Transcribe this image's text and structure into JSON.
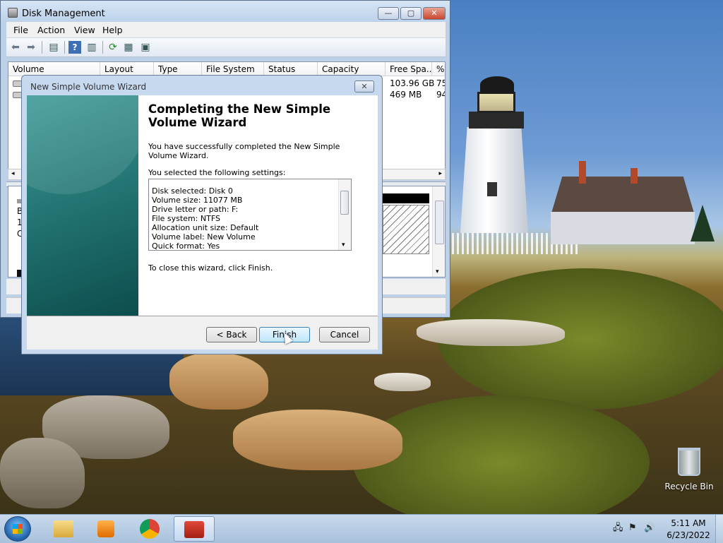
{
  "disk_management": {
    "title": "Disk Management",
    "caption_buttons": {
      "minimize": "—",
      "maximize": "▢",
      "close": "✕"
    },
    "menu": [
      "File",
      "Action",
      "View",
      "Help"
    ],
    "toolbar_icons": [
      "back-arrow-icon",
      "forward-arrow-icon",
      "console-tree-icon",
      "help-icon",
      "show-hide-icon",
      "refresh-icon",
      "properties-icon",
      "disk-settings-icon"
    ],
    "columns": [
      "Volume",
      "Layout",
      "Type",
      "File System",
      "Status",
      "Capacity",
      "Free Spa...",
      "%"
    ],
    "rows": [
      {
        "free": "103.96 GB",
        "pct": "75"
      },
      {
        "free": "469 MB",
        "pct": "94"
      }
    ],
    "lower_fragments": [
      "B",
      "1:",
      "C"
    ]
  },
  "wizard": {
    "title": "New Simple Volume Wizard",
    "close_label": "✕",
    "heading": "Completing the New Simple Volume Wizard",
    "success_text": "You have successfully completed the New Simple Volume Wizard.",
    "settings_label": "You selected the following settings:",
    "settings": [
      "Disk selected: Disk 0",
      "Volume size: 11077 MB",
      "Drive letter or path: F:",
      "File system: NTFS",
      "Allocation unit size: Default",
      "Volume label: New Volume",
      "Quick format: Yes"
    ],
    "close_instruction": "To close this wizard, click Finish.",
    "buttons": {
      "back": "< Back",
      "finish": "Finish",
      "cancel": "Cancel"
    }
  },
  "desktop": {
    "recycle_bin_label": "Recycle Bin"
  },
  "taskbar": {
    "pinned": [
      "windows-explorer-icon",
      "media-player-icon",
      "chrome-icon",
      "computer-management-icon"
    ],
    "clock_time": "5:11 AM",
    "clock_date": "6/23/2022"
  },
  "colors": {
    "wizard_banner": "#1f6f6e",
    "taskbar": "#a9c1dc",
    "close_button": "#c9452e"
  }
}
